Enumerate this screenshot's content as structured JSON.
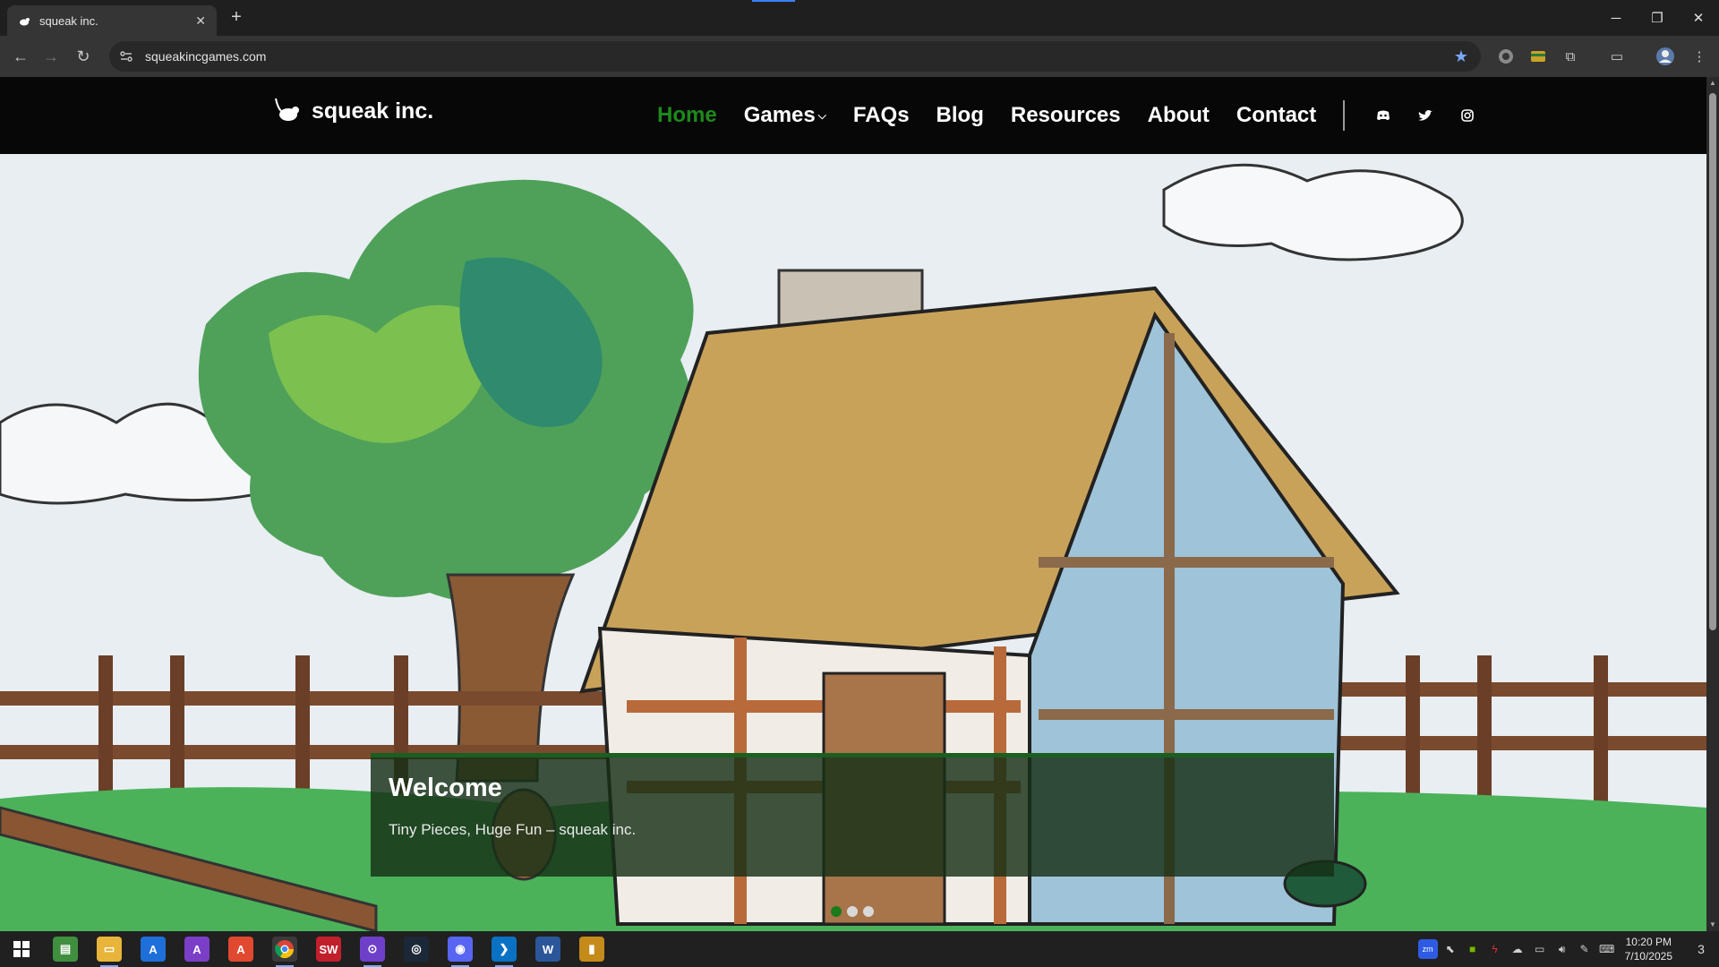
{
  "browser": {
    "tab_title": "squeak inc.",
    "tab_close": "✕",
    "new_tab": "+",
    "url": "squeakincgames.com",
    "window_controls": {
      "minimize": "─",
      "restore": "❐",
      "close": "✕"
    }
  },
  "site": {
    "brand": "squeak inc.",
    "nav": {
      "home": "Home",
      "games": "Games",
      "faqs": "FAQs",
      "blog": "Blog",
      "resources": "Resources",
      "about": "About",
      "contact": "Contact"
    },
    "social": [
      "discord-icon",
      "twitter-icon",
      "instagram-icon"
    ],
    "accent_color": "#1d8a1d",
    "hero": {
      "heading": "Welcome",
      "tagline": "Tiny Pieces, Huge Fun – squeak inc.",
      "slide_count": 3,
      "active_slide": 1
    }
  },
  "taskbar": {
    "apps": [
      "windows-start",
      "notepad",
      "file-explorer",
      "affinity-designer",
      "affinity-photo",
      "affinity-publisher",
      "chrome",
      "substance",
      "github-desktop",
      "steam",
      "discord",
      "vscode",
      "word",
      "sketchup"
    ],
    "time": "10:20 PM",
    "date": "7/10/2025",
    "notifications": "3"
  }
}
